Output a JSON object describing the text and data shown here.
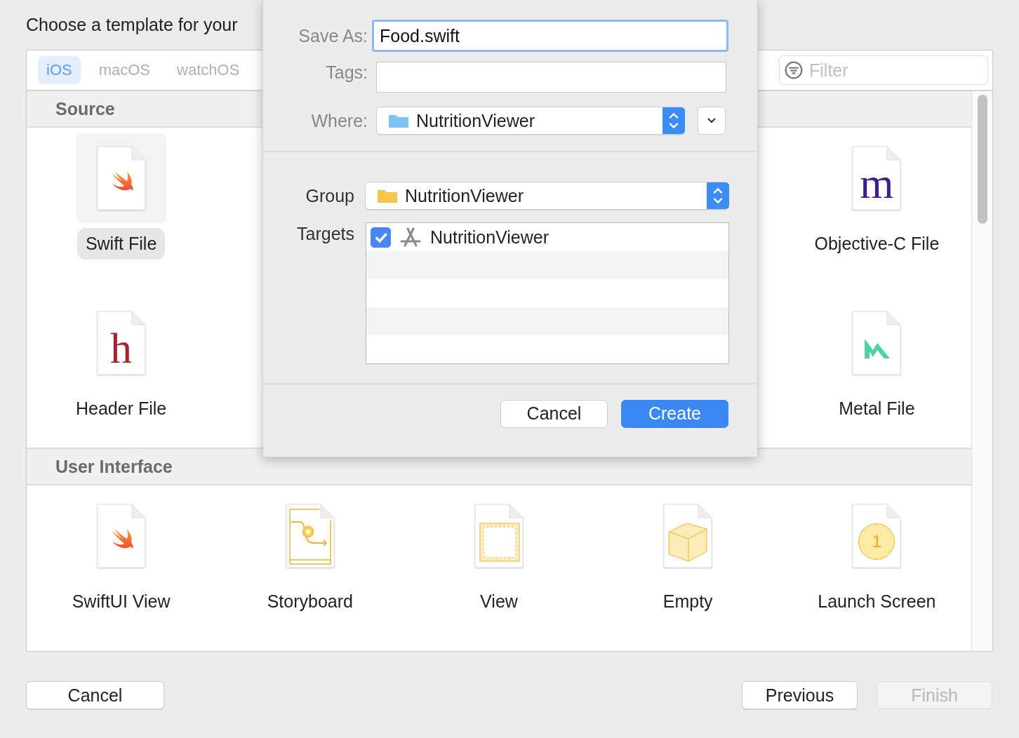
{
  "title": "Choose a template for your",
  "platform_tabs": [
    {
      "label": "iOS",
      "selected": true
    },
    {
      "label": "macOS",
      "selected": false
    },
    {
      "label": "watchOS",
      "selected": false
    }
  ],
  "filter": {
    "placeholder": "Filter"
  },
  "sections": [
    {
      "title": "Source",
      "items": [
        {
          "kind": "swift",
          "label": "Swift File",
          "selected": true
        },
        {
          "kind": "letter",
          "glyph": "m",
          "label": "Objective-C File",
          "selected": false
        },
        {
          "kind": "letter",
          "glyph": "h",
          "label": "Header File",
          "selected": false
        },
        {
          "kind": "metal",
          "label": "Metal File",
          "selected": false
        }
      ]
    },
    {
      "title": "User Interface",
      "items": [
        {
          "kind": "swift",
          "label": "SwiftUI View",
          "selected": false
        },
        {
          "kind": "storyboard",
          "label": "Storyboard",
          "selected": false
        },
        {
          "kind": "view",
          "label": "View",
          "selected": false
        },
        {
          "kind": "cube",
          "label": "Empty",
          "selected": false
        },
        {
          "kind": "launch",
          "glyph": "1",
          "label": "Launch Screen",
          "selected": false
        }
      ]
    }
  ],
  "save_sheet": {
    "save_as": {
      "label": "Save As:",
      "value": "Food.swift"
    },
    "tags": {
      "label": "Tags:"
    },
    "where": {
      "label": "Where:",
      "value": "NutritionViewer"
    },
    "group": {
      "label": "Group",
      "value": "NutritionViewer"
    },
    "targets": {
      "label": "Targets",
      "items": [
        {
          "name": "NutritionViewer",
          "checked": true
        }
      ]
    },
    "buttons": [
      {
        "label": "Cancel",
        "kind": "default"
      },
      {
        "label": "Create",
        "kind": "primary"
      }
    ]
  },
  "footer_buttons": [
    {
      "label": "Cancel",
      "disabled": false
    },
    {
      "label": "Previous",
      "disabled": false
    },
    {
      "label": "Finish",
      "disabled": true
    }
  ]
}
